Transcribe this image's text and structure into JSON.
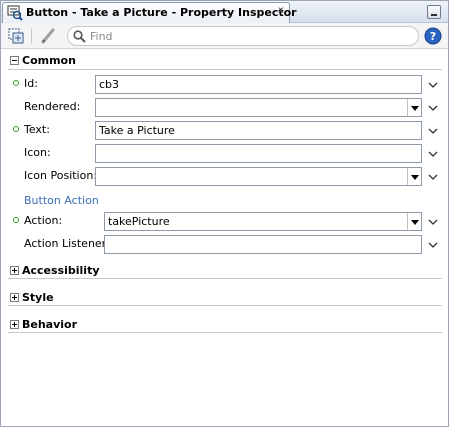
{
  "tab": {
    "title": "Button - Take a Picture - Property Inspector",
    "close_glyph": "x",
    "icon": "property-inspector-icon"
  },
  "toolbar": {
    "search_placeholder": "Find",
    "icons": [
      "binding-icon",
      "edit-pencil-icon",
      "search-icon",
      "help-icon"
    ],
    "help_glyph": "?"
  },
  "sections": {
    "common": {
      "label": "Common",
      "expanded": true
    },
    "accessibility": {
      "label": "Accessibility",
      "expanded": false
    },
    "style": {
      "label": "Style",
      "expanded": false
    },
    "behavior": {
      "label": "Behavior",
      "expanded": false
    }
  },
  "properties": {
    "id": {
      "label": "Id:",
      "value": "cb3",
      "required": true
    },
    "rendered": {
      "label": "Rendered:",
      "value": ""
    },
    "text": {
      "label": "Text:",
      "value": "Take a Picture",
      "required": true
    },
    "icon": {
      "label": "Icon:",
      "value": ""
    },
    "icon_position": {
      "label": "Icon Position:",
      "value": ""
    },
    "group_button_action": "Button Action",
    "action": {
      "label": "Action:",
      "value": "takePicture",
      "required": true
    },
    "action_listener": {
      "label": "Action Listener:",
      "value": ""
    }
  },
  "colors": {
    "required_dot": "#3a9a2a",
    "group_label": "#3b6fb6"
  }
}
